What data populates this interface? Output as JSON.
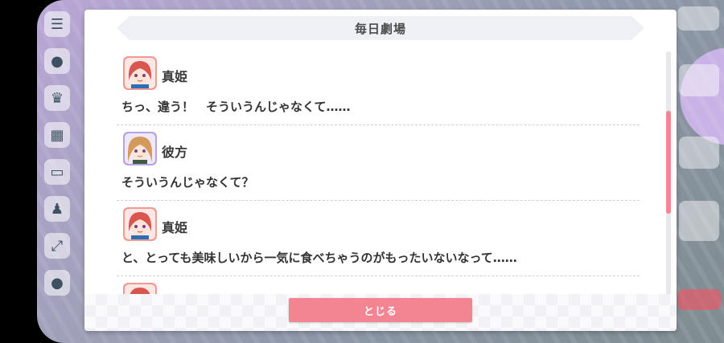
{
  "dialog": {
    "title": "毎日劇場",
    "close_label": "とじる"
  },
  "entries": [
    {
      "speaker": "真姫",
      "avatar": "maki-avatar",
      "text": "ちっ、違う！　そういうんじゃなくて……"
    },
    {
      "speaker": "彼方",
      "avatar": "kanata-avatar",
      "text": "そういうんじゃなくて？"
    },
    {
      "speaker": "真姫",
      "avatar": "maki-avatar",
      "text": "と、とっても美味しいから一気に食べちゃうのがもったいないなって……"
    }
  ],
  "scrollbar": {
    "position_fraction": 0.42
  },
  "colors": {
    "accent": "#f28591",
    "header_bg": "#eff0f5",
    "maki_hair": "#d9564f",
    "kanata_hair": "#d49a5b"
  }
}
